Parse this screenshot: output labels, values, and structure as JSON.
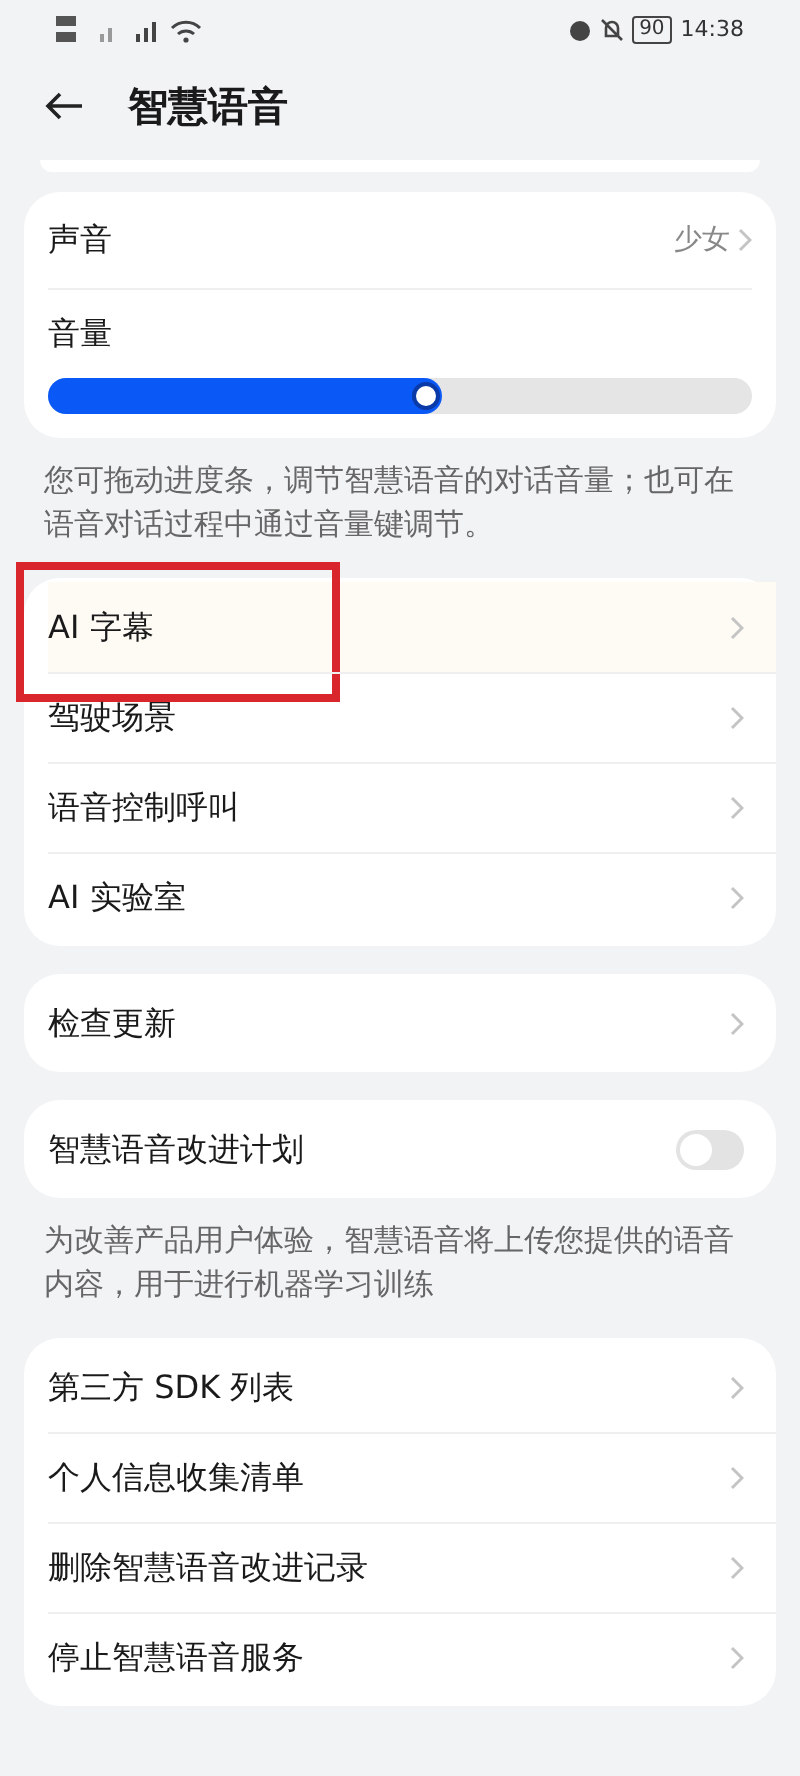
{
  "status_bar": {
    "battery": "90",
    "time": "14:38"
  },
  "header": {
    "title": "智慧语音"
  },
  "voice_card": {
    "voice": {
      "label": "声音",
      "value": "少女"
    },
    "volume": {
      "label": "音量",
      "level": 0.56
    }
  },
  "volume_note": "您可拖动进度条，调节智慧语音的对话音量；也可在语音对话过程中通过音量键调节。",
  "groups": [
    {
      "items": [
        {
          "label": "AI 字幕",
          "kind": "link",
          "highlighted": true
        },
        {
          "label": "驾驶场景",
          "kind": "link",
          "highlighted": false
        },
        {
          "label": "语音控制呼叫",
          "kind": "link",
          "highlighted": false
        },
        {
          "label": "AI 实验室",
          "kind": "link",
          "highlighted": false
        }
      ]
    },
    {
      "items": [
        {
          "label": "检查更新",
          "kind": "link",
          "highlighted": false
        }
      ]
    },
    {
      "items": [
        {
          "label": "智慧语音改进计划",
          "kind": "switch",
          "on": false,
          "highlighted": false
        }
      ],
      "note": "为改善产品用户体验，智慧语音将上传您提供的语音内容，用于进行机器学习训练"
    },
    {
      "items": [
        {
          "label": "第三方 SDK 列表",
          "kind": "link",
          "highlighted": false
        },
        {
          "label": "个人信息收集清单",
          "kind": "link",
          "highlighted": false
        },
        {
          "label": "删除智慧语音改进记录",
          "kind": "link",
          "highlighted": false
        },
        {
          "label": "停止智慧语音服务",
          "kind": "link",
          "highlighted": false
        }
      ]
    }
  ]
}
